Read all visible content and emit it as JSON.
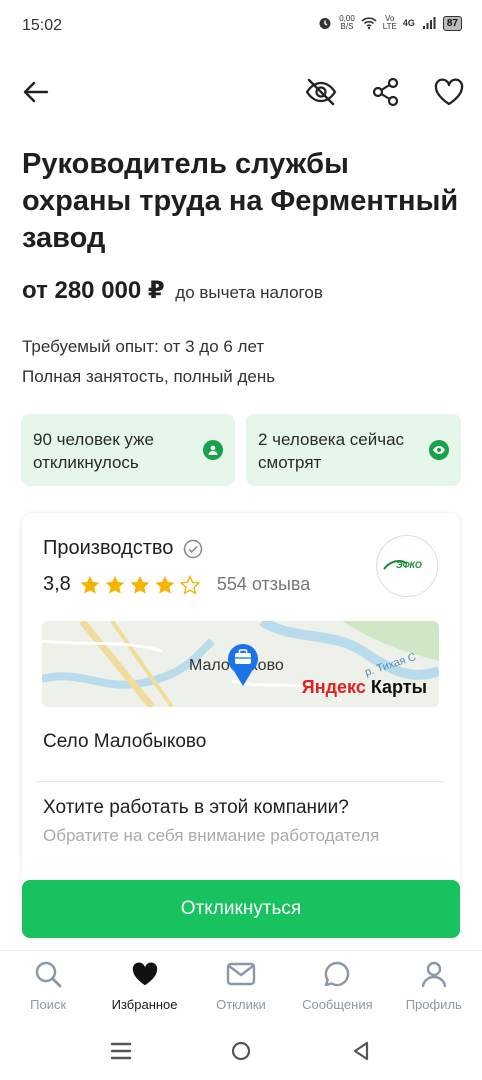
{
  "status_bar": {
    "time": "15:02",
    "net_speed_value": "0,00",
    "net_speed_unit": "B/S",
    "volte_top": "Vo",
    "volte_bottom": "LTE",
    "network": "4G",
    "battery": "87"
  },
  "vacancy": {
    "title": "Руководитель службы охраны труда на Ферментный завод",
    "salary": "от 280 000 ₽",
    "salary_note": "до вычета налогов",
    "experience": "Требуемый опыт: от 3 до 6 лет",
    "employment": "Полная занятость, полный день"
  },
  "stats": {
    "responded": "90 человек уже откликнулось",
    "watching": "2 человека сейчас смотрят"
  },
  "company": {
    "name": "Производство",
    "rating": "3,8",
    "stars_filled": 4,
    "stars_total": 5,
    "reviews": "554 отзыва",
    "logo_text": "ЭФКО",
    "map_village": "Малобыково",
    "map_river": "р. Тихая С",
    "map_brand_ya": "Яндекс",
    "map_brand_rest": " Карты",
    "address": "Село Малобыково",
    "cta_question": "Хотите работать в этой компании?",
    "cta_sub": "Обратите на себя внимание работодателя"
  },
  "apply_label": "Откликнуться",
  "nav": [
    {
      "label": "Поиск",
      "icon": "search-icon"
    },
    {
      "label": "Избранное",
      "icon": "heart-filled-icon"
    },
    {
      "label": "Отклики",
      "icon": "mail-icon"
    },
    {
      "label": "Сообщения",
      "icon": "chat-icon"
    },
    {
      "label": "Профиль",
      "icon": "profile-icon"
    }
  ],
  "colors": {
    "accent": "#17c25f",
    "stat_bg": "#e6f6ea",
    "star": "#f5b400"
  }
}
